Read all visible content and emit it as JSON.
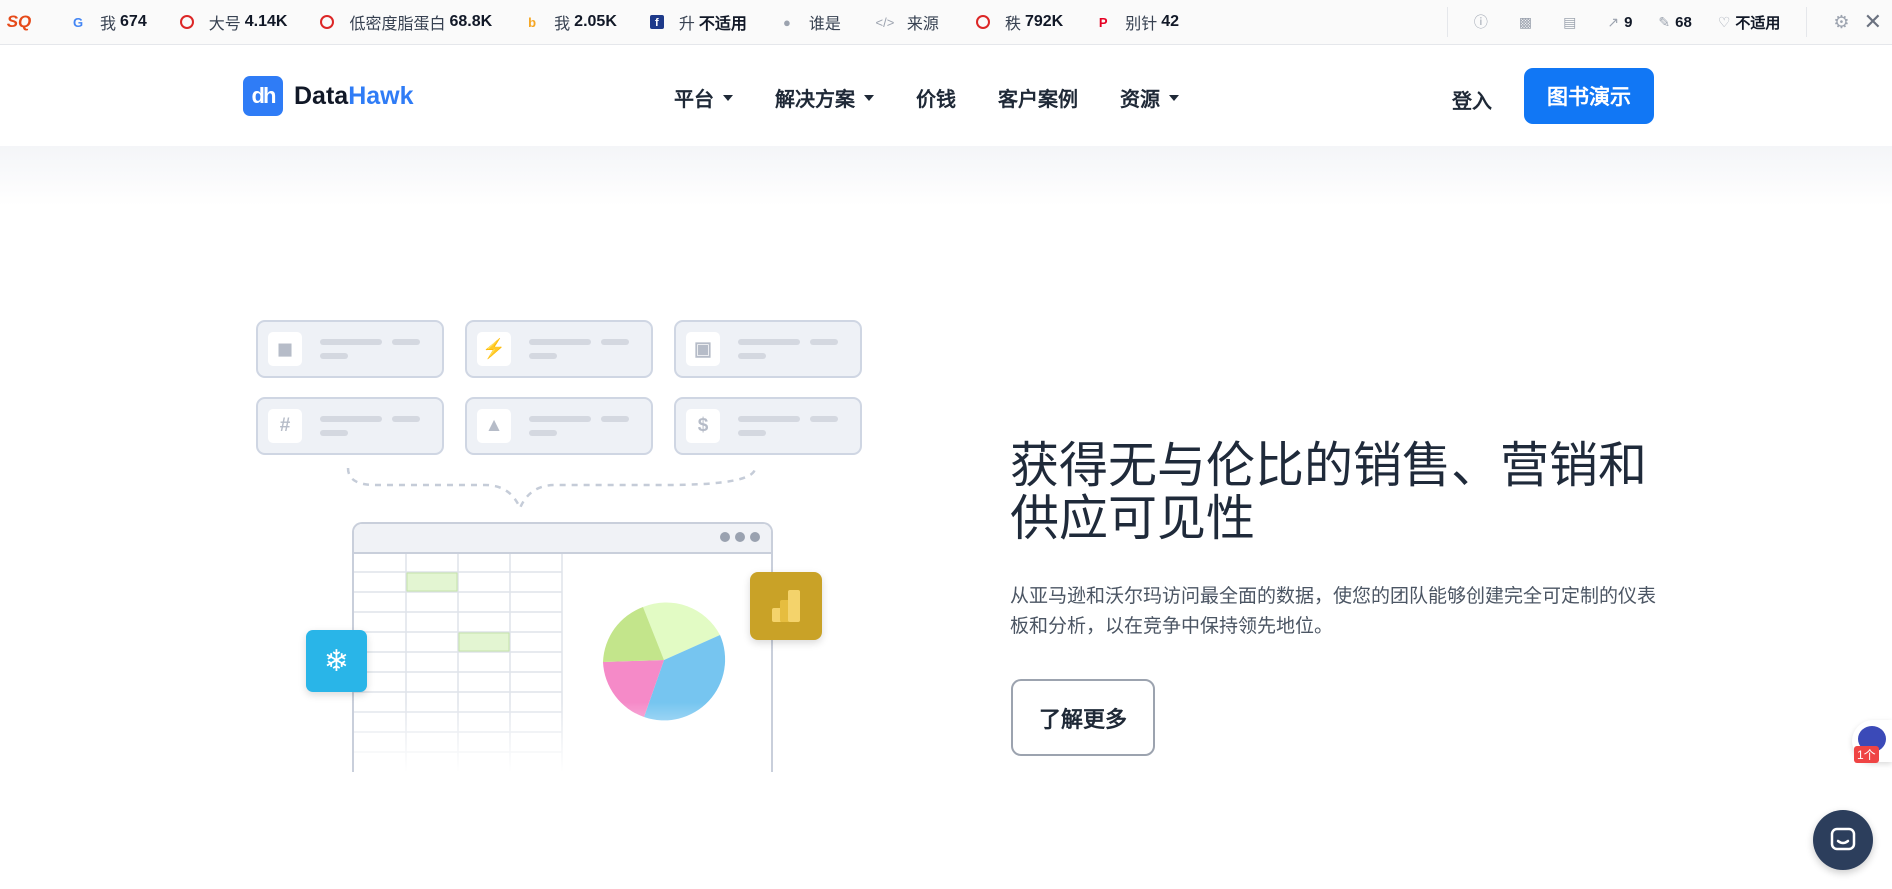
{
  "seo_toolbar": {
    "items": [
      {
        "icon": "google-icon",
        "label": "我",
        "value": "674"
      },
      {
        "icon": "circle-icon",
        "label": "大号",
        "value": "4.14K"
      },
      {
        "icon": "circle-icon",
        "label": "低密度脂蛋白",
        "value": "68.8K"
      },
      {
        "icon": "bing-icon",
        "label": "我",
        "value": "2.05K"
      },
      {
        "icon": "facebook-icon",
        "label": "升",
        "value": "不适用"
      },
      {
        "icon": "user-icon",
        "label": "谁是",
        "value": ""
      },
      {
        "icon": "code-icon",
        "label": "来源",
        "value": ""
      },
      {
        "icon": "circle-icon",
        "label": "秩",
        "value": "792K"
      },
      {
        "icon": "pinterest-icon",
        "label": "别针",
        "value": "42"
      }
    ],
    "right": {
      "external_links": "9",
      "pages": "68",
      "health": "不适用"
    }
  },
  "nav": {
    "brand_prefix": "Data",
    "brand_suffix": "Hawk",
    "brand_mark": "dh",
    "menu": [
      {
        "label": "平台",
        "has_dropdown": true
      },
      {
        "label": "解决方案",
        "has_dropdown": true
      },
      {
        "label": "价钱",
        "has_dropdown": false
      },
      {
        "label": "客户案例",
        "has_dropdown": false
      },
      {
        "label": "资源",
        "has_dropdown": true
      }
    ],
    "login": "登入",
    "demo": "图书演示"
  },
  "hero": {
    "title": "获得无与伦比的销售、营销和供应可见性",
    "subtitle": "从亚马逊和沃尔玛访问最全面的数据，使您的团队能够创建完全可定制的仪表板和分析，以在竞争中保持领先地位。",
    "cta": "了解更多"
  },
  "illustration": {
    "card_icons": [
      "box-icon",
      "plug-icon",
      "wallet-icon",
      "hashtag-icon",
      "shapes-icon",
      "dollar-plug-icon"
    ],
    "pie_colors": [
      "#e2fbc4",
      "#76c5f0",
      "#f58ac8",
      "#c3e58b"
    ],
    "accent_colors": {
      "snowflake": "#29b5e8",
      "powerbi": "#c9a227",
      "brand": "#2f7cf6",
      "primary_button": "#1177f5"
    }
  },
  "widgets": {
    "badge": "1个"
  }
}
